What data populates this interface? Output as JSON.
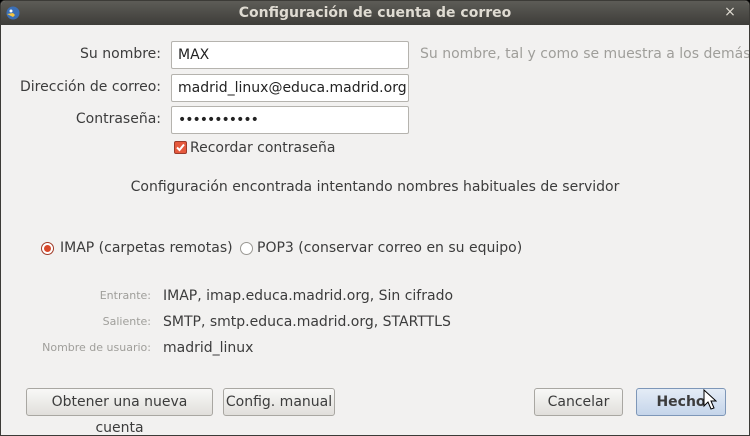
{
  "window": {
    "title": "Configuración de cuenta de correo",
    "close_symbol": "×"
  },
  "form": {
    "name_label": "Su nombre:",
    "name_value": "MAX",
    "name_hint": "Su nombre, tal y como se muestra a los demás",
    "email_label": "Dirección de correo:",
    "email_value": "madrid_linux@educa.madrid.org",
    "password_label": "Contraseña:",
    "password_value": "•••••••••••",
    "remember_label": "Recordar contraseña",
    "remember_checked": true
  },
  "status_text": "Configuración encontrada intentando nombres habituales de servidor",
  "protocols": [
    {
      "label": "IMAP (carpetas remotas)",
      "selected": true
    },
    {
      "label": "POP3 (conservar correo en su equipo)",
      "selected": false
    }
  ],
  "server": {
    "incoming_label": "Entrante:",
    "incoming_value": "IMAP, imap.educa.madrid.org, Sin cifrado",
    "outgoing_label": "Saliente:",
    "outgoing_value": "SMTP, smtp.educa.madrid.org, STARTTLS",
    "username_label": "Nombre de usuario:",
    "username_value": "madrid_linux"
  },
  "buttons": {
    "new_account": "Obtener una nueva cuenta",
    "manual_config": "Config. manual",
    "cancel": "Cancelar",
    "done": "Hecho"
  },
  "colors": {
    "titlebar": "#3e3d39",
    "accent": "#e5593d",
    "background": "#f2f1f0"
  }
}
